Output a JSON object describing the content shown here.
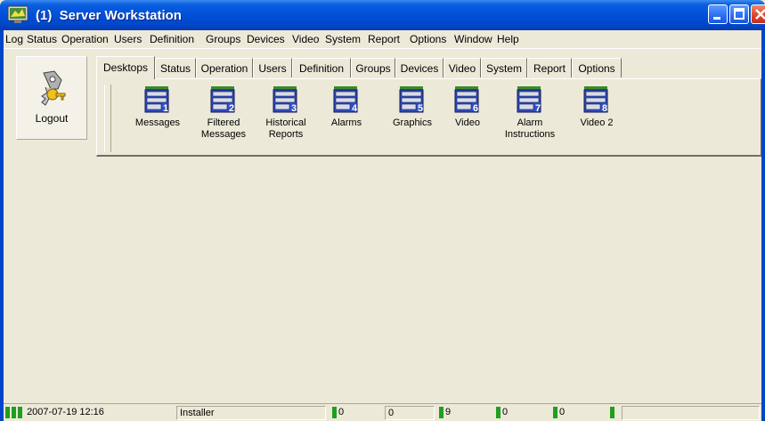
{
  "window": {
    "title": "(1)  Server Workstation",
    "controls": [
      "minimize",
      "maximize",
      "close"
    ]
  },
  "menu": [
    "Log",
    "Status",
    "Operation",
    "Users",
    "Definition",
    "Groups",
    "Devices",
    "Video",
    "System",
    "Report",
    "Options",
    "Window",
    "Help"
  ],
  "toolbar": {
    "logout_label": "Logout",
    "tabs": [
      "Desktops",
      "Status",
      "Operation",
      "Users",
      "Definition",
      "Groups",
      "Devices",
      "Video",
      "System",
      "Report",
      "Options"
    ],
    "active_tab": "Desktops",
    "desktops": [
      {
        "num": "1",
        "label": "Messages"
      },
      {
        "num": "2",
        "label": "Filtered\nMessages"
      },
      {
        "num": "3",
        "label": "Historical\nReports"
      },
      {
        "num": "4",
        "label": "Alarms"
      },
      {
        "num": "5",
        "label": "Graphics"
      },
      {
        "num": "6",
        "label": "Video"
      },
      {
        "num": "7",
        "label": "Alarm\nInstructions"
      },
      {
        "num": "8",
        "label": "Video 2"
      }
    ]
  },
  "statusbar": {
    "datetime": "2007-07-19 12:16",
    "user": "Installer",
    "counter1": "0",
    "counter2": "0",
    "counter3": "9",
    "counter4": "0",
    "counter5": "0"
  },
  "colors": {
    "titlebar": "#0050d8",
    "led_green": "#1ea01e",
    "desktop_icon_blue": "#2040c0",
    "desktop_icon_green": "#3a8a2a"
  }
}
